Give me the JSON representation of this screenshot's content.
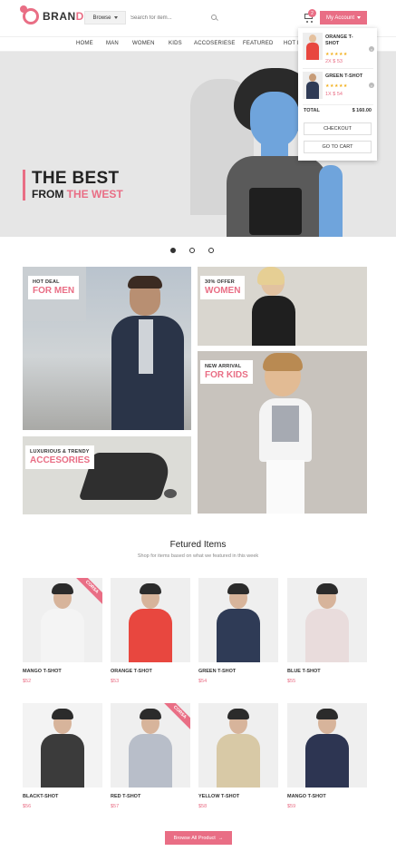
{
  "brand": {
    "name_main": "BRAN",
    "name_accent": "D"
  },
  "header": {
    "browse_label": "Browse",
    "search_placeholder": "Search for item...",
    "cart_count": "2",
    "account_label": "My Account"
  },
  "nav": {
    "items": [
      "HOME",
      "MAN",
      "WOMEN",
      "KIDS",
      "ACCOSERIESE",
      "FEATURED",
      "HOT D"
    ]
  },
  "hero": {
    "title": "THE BEST",
    "sub_prefix": "FROM",
    "sub_accent": "THE WEST",
    "slide_count": 3,
    "active_slide": 1
  },
  "promos": {
    "men": {
      "small": "HOT DEAL",
      "big": "FOR MEN"
    },
    "women": {
      "small": "30% OFFER",
      "big": "WOMEN"
    },
    "kids": {
      "small": "NEW ARRIVAL",
      "big": "FOR KIDS"
    },
    "accessories": {
      "small": "LUXURIOUS & TRENDY",
      "big": "ACCESORIES"
    }
  },
  "featured": {
    "title": "Fetured Items",
    "subtitle": "Shop for items based on what we featured in this week",
    "products": [
      {
        "name": "MANGO T-SHOT",
        "price": "$52",
        "ribbon": "CORSA",
        "shirt": "#f4f4f4",
        "bg": "#efefef"
      },
      {
        "name": "ORANGE T-SHOT",
        "price": "$53",
        "ribbon": "",
        "shirt": "#e8473f",
        "bg": "#efefef"
      },
      {
        "name": "GREEN T-SHOT",
        "price": "$54",
        "ribbon": "",
        "shirt": "#2f3b56",
        "bg": "#efefef"
      },
      {
        "name": "BLUE T-SHOT",
        "price": "$55",
        "ribbon": "",
        "shirt": "#e9dcdc",
        "bg": "#efefef"
      },
      {
        "name": "BLACKT-SHOT",
        "price": "$56",
        "ribbon": "",
        "shirt": "#3b3b3b",
        "bg": "#f3f3f3"
      },
      {
        "name": "RED T-SHOT",
        "price": "$57",
        "ribbon": "CORSA",
        "shirt": "#b8bec9",
        "bg": "#efefef"
      },
      {
        "name": "YELLOW T-SHOT",
        "price": "$58",
        "ribbon": "",
        "shirt": "#d8c9a6",
        "bg": "#efefef"
      },
      {
        "name": "MANGO T-SHOT",
        "price": "$59",
        "ribbon": "",
        "shirt": "#2d3552",
        "bg": "#efefef"
      }
    ],
    "browse_all_label": "Browse All Product"
  },
  "cart_dropdown": {
    "items": [
      {
        "name": "ORANGE T-SHOT",
        "stars": "★★★★★",
        "qty_price": "2X $ 53",
        "thumb_color": "#e8473f"
      },
      {
        "name": "GREEN T-SHOT",
        "stars": "★★★★★",
        "qty_price": "1X $ 54",
        "thumb_color": "#2f3b56"
      }
    ],
    "total_label": "TOTAL",
    "total_value": "$ 160.00",
    "checkout_label": "CHECKOUT",
    "go_to_cart_label": "GO TO CART"
  },
  "colors": {
    "accent": "#e96e85",
    "dark": "#222222"
  }
}
